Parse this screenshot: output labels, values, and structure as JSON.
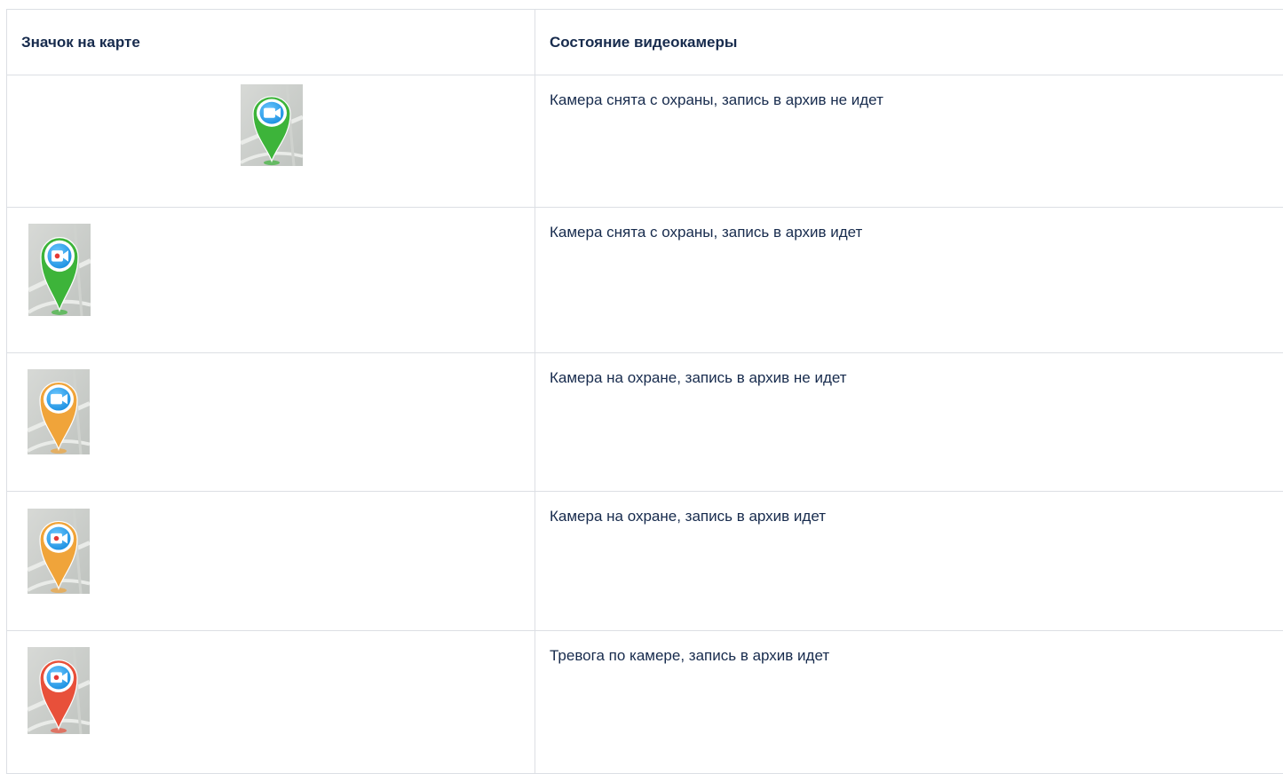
{
  "table": {
    "headers": {
      "icon": "Значок на карте",
      "state": "Состояние видеокамеры"
    },
    "rows": [
      {
        "state": "Камера снята с охраны, запись в архив не идет",
        "pin_color": "#3db43a",
        "glyph": "camera-icon",
        "recording": false,
        "align": "center"
      },
      {
        "state": "Камера снята с охраны, запись в архив идет",
        "pin_color": "#3db43a",
        "glyph": "camera-recording-icon",
        "recording": true,
        "align": "left"
      },
      {
        "state": "Камера на охране, запись в архив не идет",
        "pin_color": "#f0a43a",
        "glyph": "camera-icon",
        "recording": false,
        "align": "left"
      },
      {
        "state": "Камера на охране, запись в архив идет",
        "pin_color": "#f0a43a",
        "glyph": "camera-recording-icon",
        "recording": true,
        "align": "left"
      },
      {
        "state": "Тревога по камере, запись в архив идет",
        "pin_color": "#e8503a",
        "glyph": "camera-recording-icon",
        "recording": true,
        "align": "left"
      }
    ]
  }
}
